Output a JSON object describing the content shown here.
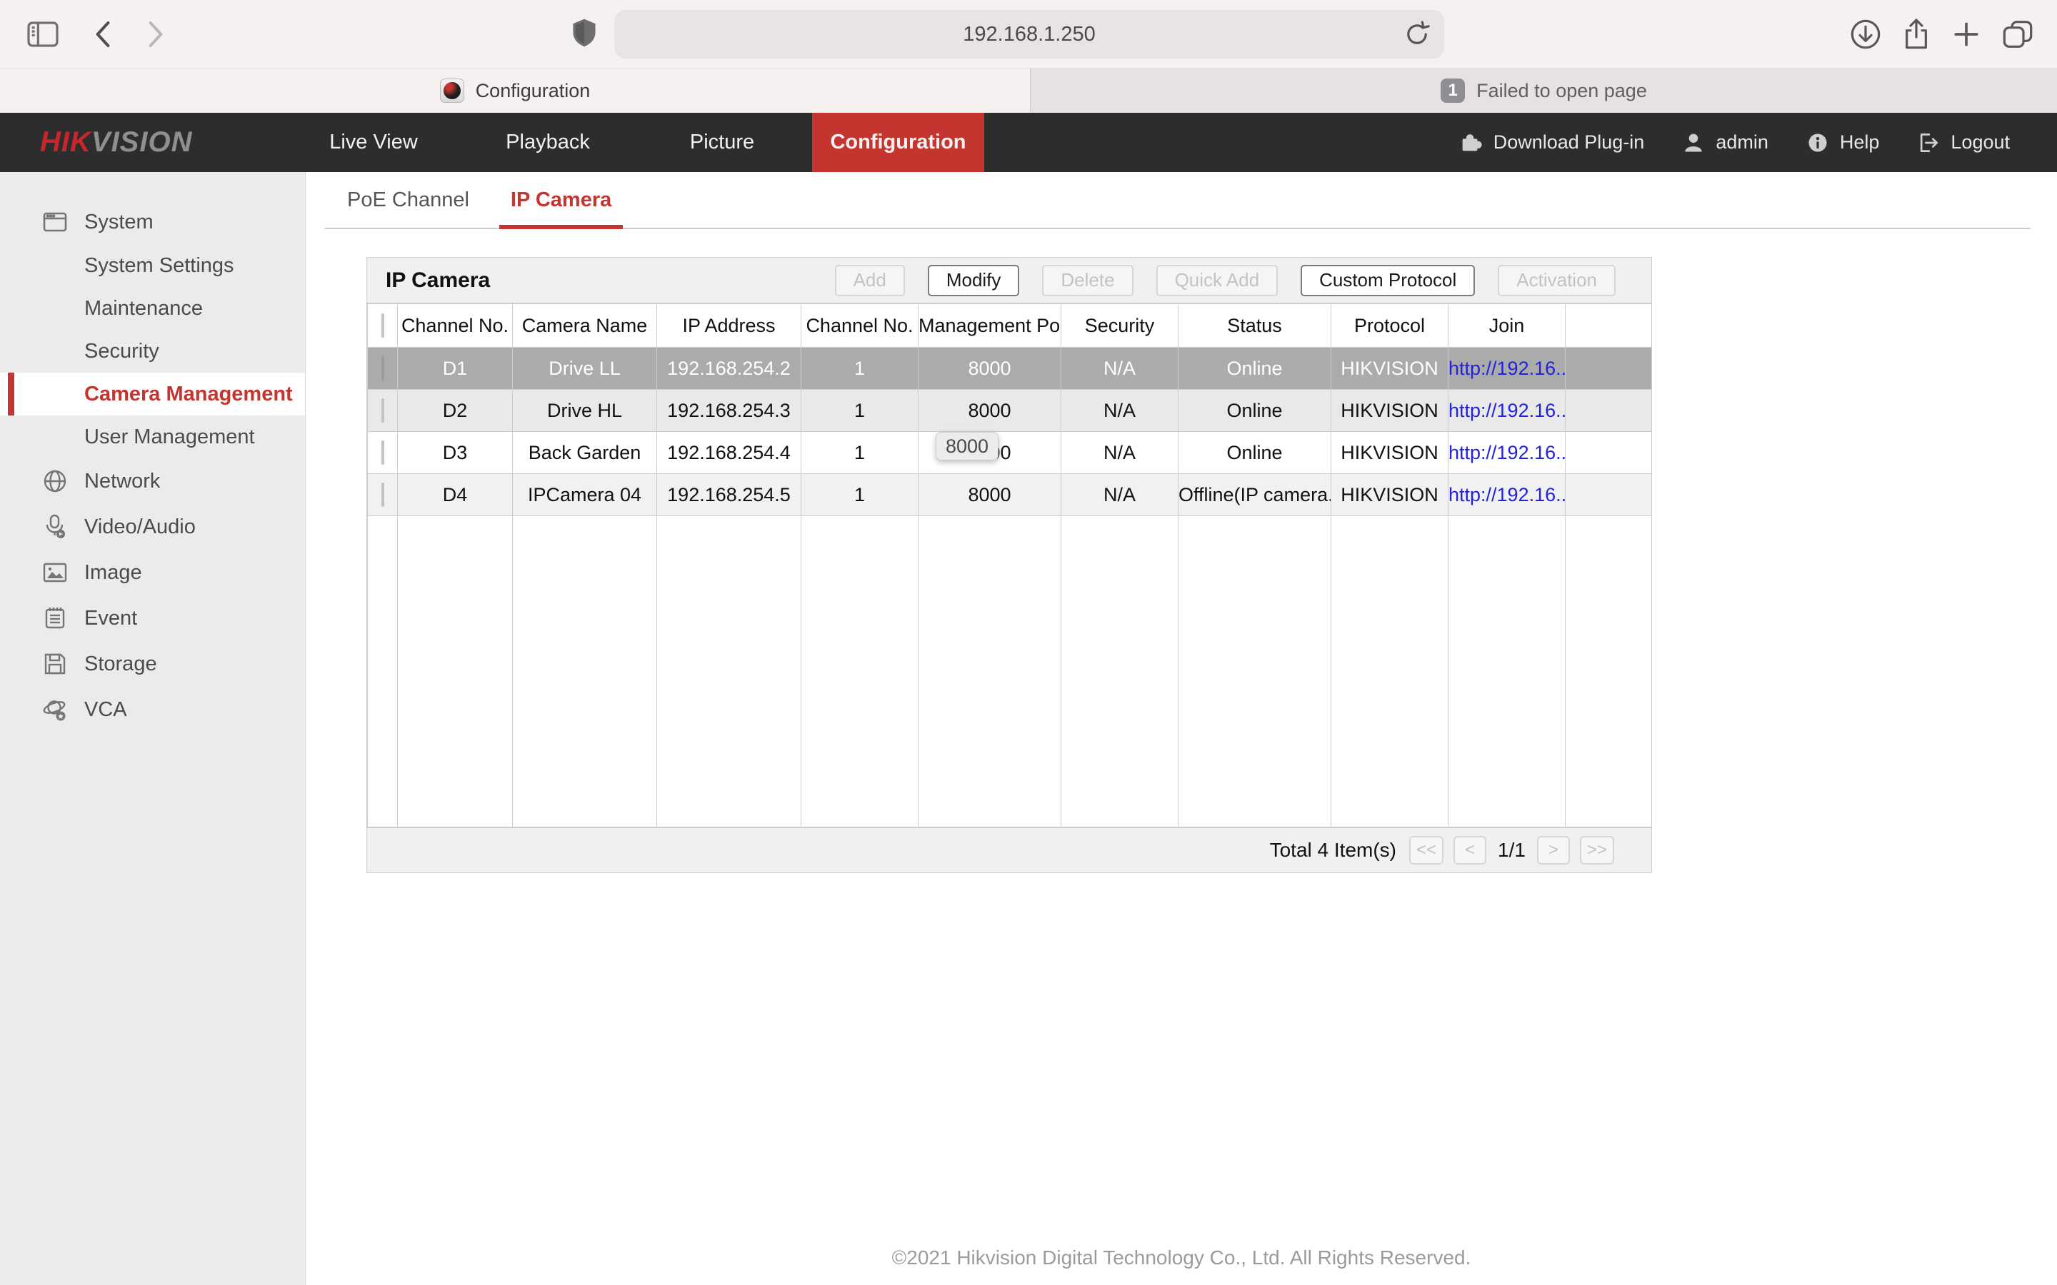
{
  "colors": {
    "accent_red": "#c5352f",
    "logo_red": "#c9252c",
    "link_blue": "#2222dd",
    "selected_row_gray": "#ababab",
    "nav_dark": "#2d2d2d"
  },
  "browser": {
    "url": "192.168.1.250",
    "active_tab": {
      "label": "Configuration"
    },
    "inactive_tab": {
      "badge": "1",
      "label": "Failed to open page"
    }
  },
  "app_header": {
    "logo": {
      "hik": "HIK",
      "vision": "VISION"
    },
    "nav": [
      {
        "label": "Live View"
      },
      {
        "label": "Playback"
      },
      {
        "label": "Picture"
      },
      {
        "label": "Configuration"
      }
    ],
    "utility": [
      {
        "label": "Download Plug-in"
      },
      {
        "label": "admin"
      },
      {
        "label": "Help"
      },
      {
        "label": "Logout"
      }
    ]
  },
  "sidebar": {
    "items": [
      {
        "label": "System"
      },
      {
        "label": "System Settings"
      },
      {
        "label": "Maintenance"
      },
      {
        "label": "Security"
      },
      {
        "label": "Camera Management"
      },
      {
        "label": "User Management"
      },
      {
        "label": "Network"
      },
      {
        "label": "Video/Audio"
      },
      {
        "label": "Image"
      },
      {
        "label": "Event"
      },
      {
        "label": "Storage"
      },
      {
        "label": "VCA"
      }
    ]
  },
  "content": {
    "tabs": [
      {
        "label": "PoE Channel"
      },
      {
        "label": "IP Camera"
      }
    ],
    "panel_title": "IP Camera",
    "toolbar": [
      {
        "label": "Add",
        "enabled": false
      },
      {
        "label": "Modify",
        "enabled": true
      },
      {
        "label": "Delete",
        "enabled": false
      },
      {
        "label": "Quick Add",
        "enabled": false
      },
      {
        "label": "Custom Protocol",
        "enabled": true
      },
      {
        "label": "Activation",
        "enabled": false
      }
    ],
    "table": {
      "columns": [
        "Channel No.",
        "Camera Name",
        "IP Address",
        "Channel No.",
        "Management Port",
        "Security",
        "Status",
        "Protocol",
        "Join"
      ],
      "rows": [
        {
          "channel_no": "D1",
          "camera_name": "Drive LL",
          "ip_address": "192.168.254.2",
          "channel": "1",
          "management_port": "8000",
          "security": "N/A",
          "status": "Online",
          "protocol": "HIKVISION",
          "join": "http://192.16..."
        },
        {
          "channel_no": "D2",
          "camera_name": "Drive HL",
          "ip_address": "192.168.254.3",
          "channel": "1",
          "management_port": "8000",
          "security": "N/A",
          "status": "Online",
          "protocol": "HIKVISION",
          "join": "http://192.16..."
        },
        {
          "channel_no": "D3",
          "camera_name": "Back Garden",
          "ip_address": "192.168.254.4",
          "channel": "1",
          "management_port": "8000",
          "security": "N/A",
          "status": "Online",
          "protocol": "HIKVISION",
          "join": "http://192.16..."
        },
        {
          "channel_no": "D4",
          "camera_name": "IPCamera 04",
          "ip_address": "192.168.254.5",
          "channel": "1",
          "management_port": "8000",
          "security": "N/A",
          "status": "Offline(IP camera...",
          "protocol": "HIKVISION",
          "join": "http://192.16..."
        }
      ],
      "tooltip": "8000"
    },
    "pagination": {
      "total": "Total 4 Item(s)",
      "first": "<<",
      "prev": "<",
      "page": "1/1",
      "next": ">",
      "last": ">>"
    },
    "copyright": "©2021 Hikvision Digital Technology Co., Ltd. All Rights Reserved."
  }
}
